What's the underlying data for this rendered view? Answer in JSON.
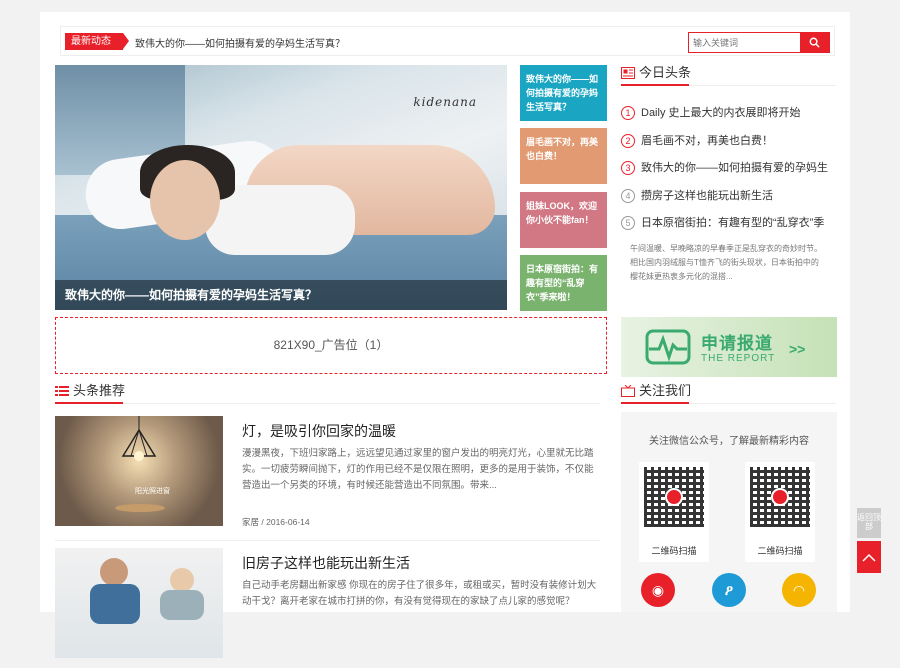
{
  "newsbar": {
    "tag": "最新动态",
    "headline": "致伟大的你——如何拍摄有爱的孕妈生活写真？"
  },
  "search": {
    "placeholder": "输入关键词"
  },
  "hero": {
    "signature": "kidenana",
    "caption": "致伟大的你——如何拍摄有爱的孕妈生活写真？"
  },
  "tiles": [
    {
      "text": "致伟大的你——如何拍摄有爱的孕妈生活写真？",
      "color": "#1aa6c2"
    },
    {
      "text": "眉毛画不对，再美也白费！",
      "color": "#e29a72"
    },
    {
      "text": "姐妹LOOK，欢迎你小伙不能fan！",
      "color": "#d27885"
    },
    {
      "text": "日本原宿街拍：有趣有型的“乱穿衣”季来啦！",
      "color": "#7ab36e"
    }
  ],
  "hot": {
    "title": "今日头条",
    "items": [
      {
        "num": "1",
        "text": "Daily 史上最大的内衣展即将开始"
      },
      {
        "num": "2",
        "text": "眉毛画不对，再美也白费！"
      },
      {
        "num": "3",
        "text": "致伟大的你——如何拍摄有爱的孕妈生"
      },
      {
        "num": "4",
        "text": "攒房子这样也能玩出新生活"
      },
      {
        "num": "5",
        "text": "日本原宿街拍：有趣有型的“乱穿衣”季"
      }
    ],
    "desc": "午间温暖、早晚略凉的早春季正是乱穿衣的奇妙时节。相比国内羽绒服与T恤齐飞的街头现状，日本街拍中的樱花妹更热衷多元化的混搭..."
  },
  "report": {
    "title": "申请报道",
    "subtitle": "THE REPORT",
    "arrow": ">>"
  },
  "ad": {
    "text": "821X90_广告位（1）"
  },
  "recommend": {
    "title": "头条推荐"
  },
  "articles": [
    {
      "title": "灯，是吸引你回家的温暖",
      "desc": "漫漫黑夜，下班归家路上，远远望见通过家里的窗户发出的明亮灯光，心里就无比踏实。一切疲劳瞬间抛下，灯的作用已经不是仅限在照明，更多的是用于装饰，不仅能营造出一个另类的环境，有时候还能营造出不同氛围。带来...",
      "category": "家居",
      "date": "2016-06-14",
      "thumb_caption": "阳光照进窗"
    },
    {
      "title": "旧房子这样也能玩出新生活",
      "desc": "自己动手老房翻出新家感 你现在的房子住了很多年，或租或买，暂时没有装修计划大动干戈？离开老家在城市打拼的你，有没有觉得现在的家缺了点儿家的感觉呢？"
    }
  ],
  "follow": {
    "title": "关注我们",
    "text": "关注微信公众号，了解最新精彩内容",
    "qr_caption_1": "二维码扫描",
    "qr_caption_2": "二维码扫描"
  },
  "float": {
    "label": "返回顶部"
  },
  "colors": {
    "accent": "#e8202a"
  }
}
